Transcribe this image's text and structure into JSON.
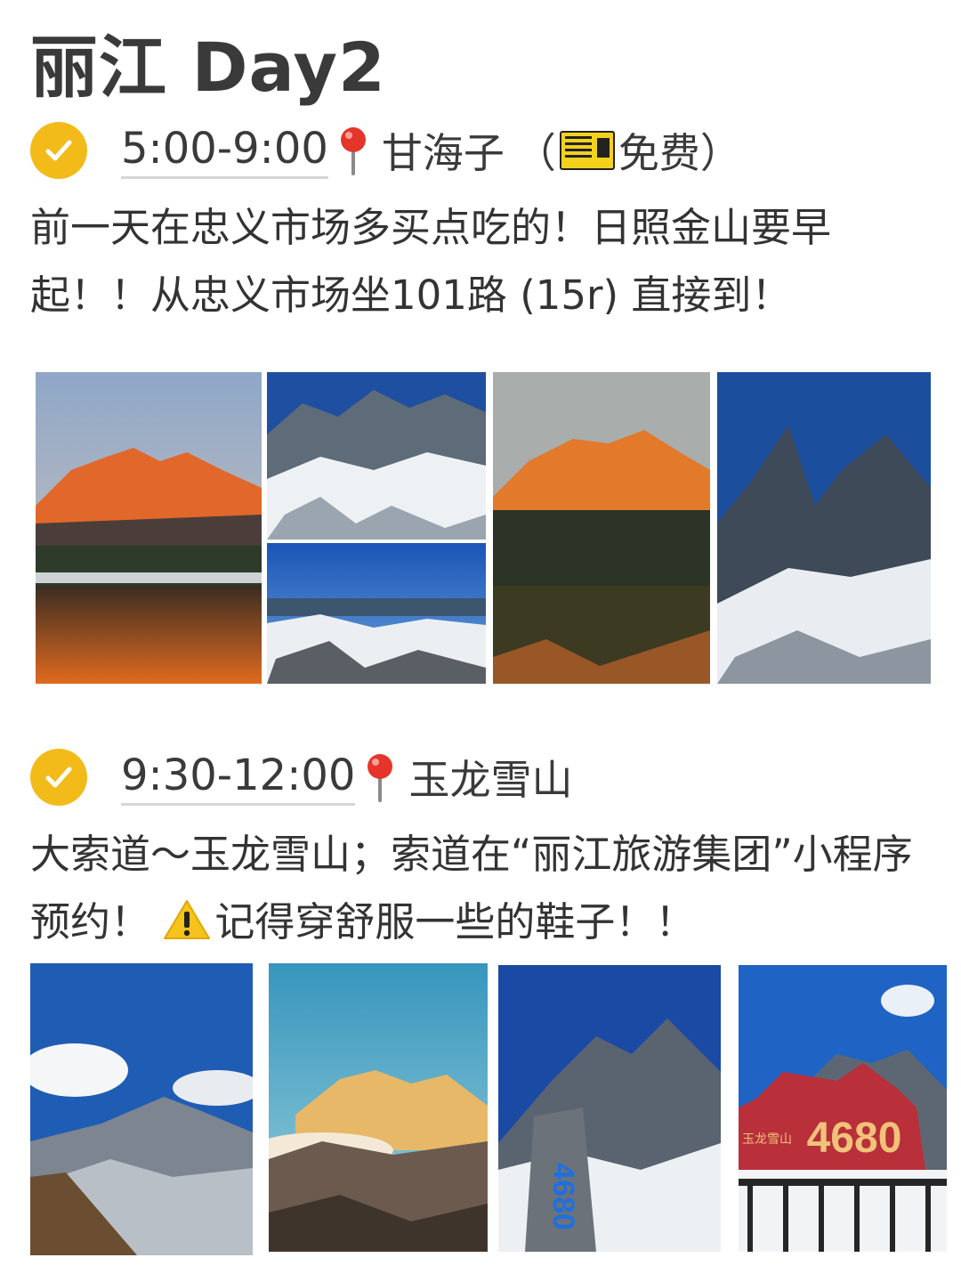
{
  "title": "丽江 Day2",
  "sections": [
    {
      "time": "5:00-9:00",
      "place": "甘海子",
      "place_note_open": "（",
      "place_note": "免费",
      "place_note_close": "）",
      "description": "前一天在忠义市场多买点吃的！日照金山要早起！！从忠义市场坐101路 (15r) 直接到！"
    },
    {
      "time": "9:30-12:00",
      "place": "玉龙雪山",
      "description_part1": "大索道～玉龙雪山；索道在“丽江旅游集团”小程序预约！",
      "description_part2": "记得穿舒服一些的鞋子！！"
    }
  ],
  "photo_label": "4680",
  "photo_sign_text": "玉龙雪山",
  "icons": {
    "check": "check-circle-icon",
    "pin": "map-pin-icon",
    "ticket": "ticket-icon",
    "warning": "warning-icon"
  },
  "colors": {
    "accent": "#f2bb19",
    "pin": "#e5352b"
  }
}
